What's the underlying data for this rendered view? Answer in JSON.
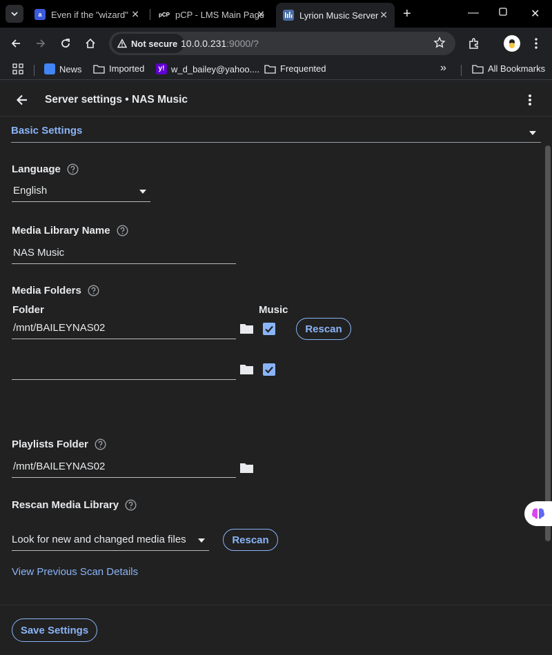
{
  "browser": {
    "tabs": [
      {
        "title": "Even if the \"wizard\"",
        "favicon": "a"
      },
      {
        "title": "pCP - LMS Main Page",
        "favicon": "pCP"
      },
      {
        "title": "Lyrion Music Server",
        "favicon": "bars"
      }
    ],
    "security_label": "Not secure",
    "url_host": "10.0.0.231",
    "url_rest": ":9000/?",
    "bookmarks": [
      {
        "label": "News",
        "icon": "news-icon"
      },
      {
        "label": "Imported",
        "icon": "folder-icon"
      },
      {
        "label": "w_d_bailey@yahoo....",
        "icon": "yahoo-icon"
      },
      {
        "label": "Frequented",
        "icon": "folder-icon"
      }
    ],
    "overflow_label": "»",
    "all_bookmarks": "All Bookmarks"
  },
  "header": {
    "title": "Server settings • NAS Music"
  },
  "section": {
    "title": "Basic Settings"
  },
  "language": {
    "label": "Language",
    "value": "English"
  },
  "library_name": {
    "label": "Media Library Name",
    "value": "NAS Music"
  },
  "media_folders": {
    "label": "Media Folders",
    "col_folder": "Folder",
    "col_music": "Music",
    "rows": [
      {
        "path": "/mnt/BAILEYNAS02",
        "music": true,
        "rescan_label": "Rescan"
      },
      {
        "path": "",
        "music": true
      }
    ]
  },
  "playlists": {
    "label": "Playlists Folder",
    "value": "/mnt/BAILEYNAS02"
  },
  "rescan": {
    "label": "Rescan Media Library",
    "mode": "Look for new and changed media files",
    "button": "Rescan"
  },
  "link_previous": "View Previous Scan Details",
  "save_label": "Save Settings",
  "colors": {
    "accent": "#8ab4f8",
    "background": "#212121",
    "text": "#e8eaed"
  }
}
